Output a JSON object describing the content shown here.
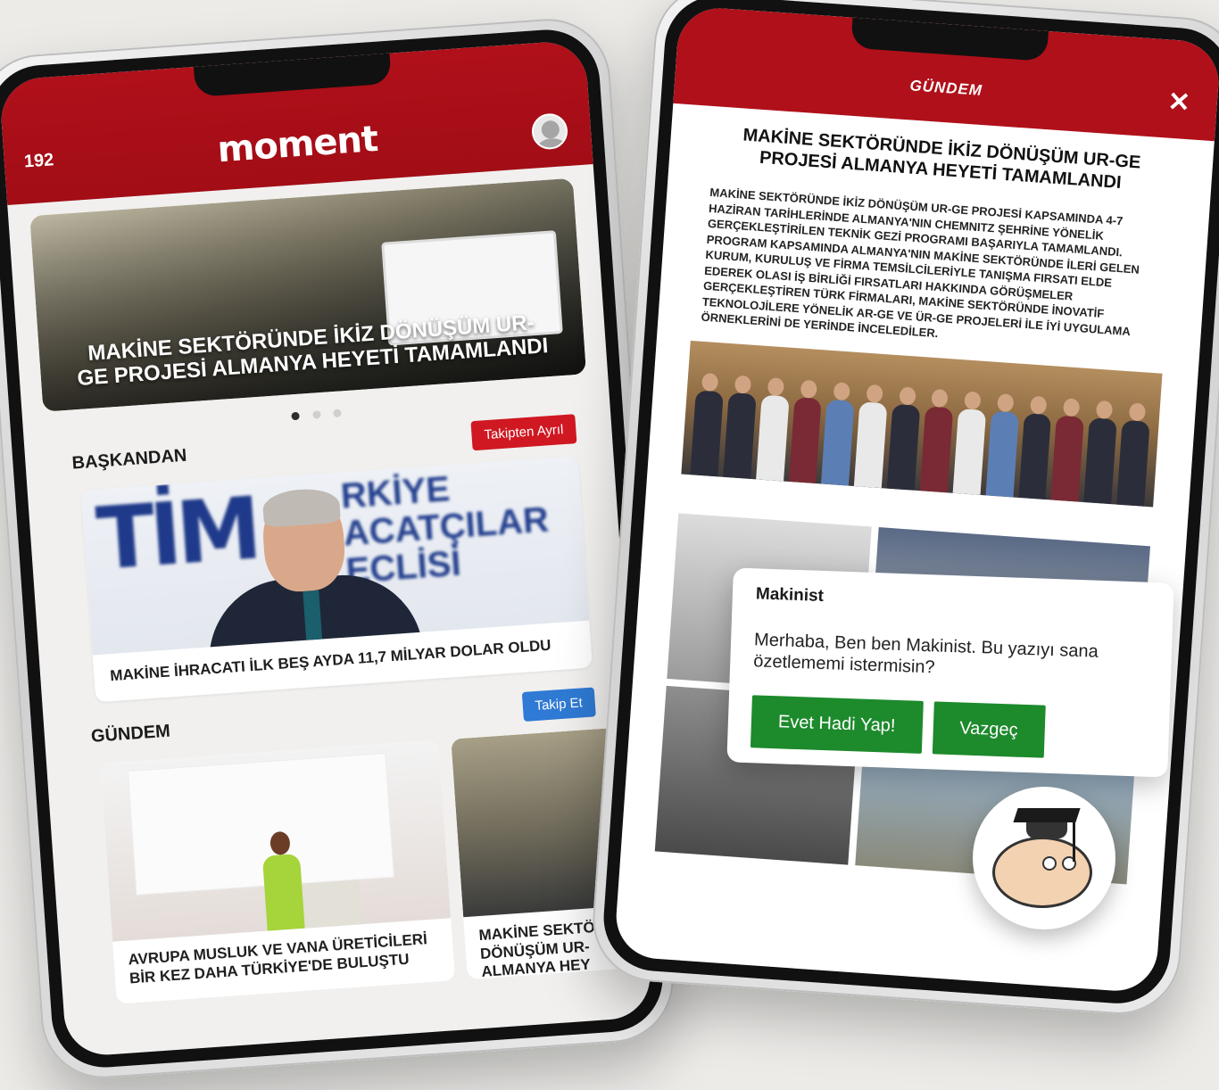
{
  "left_app": {
    "counter": "192",
    "logo": "moment",
    "hero": {
      "title": "MAKİNE SEKTÖRÜNDE İKİZ DÖNÜŞÜM UR-GE PROJESİ ALMANYA HEYETİ TAMAMLANDI"
    },
    "carousel_pages": 3,
    "baskandan": {
      "title": "BAŞKANDAN",
      "button": "Takipten Ayrıl",
      "card_logo": "TİM",
      "card_logo_sub": "RKİYE ACATÇILAR ECLİSİ",
      "card_text": "MAKİNE İHRACATI İLK BEŞ AYDA 11,7 MİLYAR DOLAR OLDU"
    },
    "gundem": {
      "title": "GÜNDEM",
      "button": "Takip Et",
      "cards": [
        {
          "text": "AVRUPA MUSLUK VE VANA ÜRETİCİLERİ BİR KEZ DAHA TÜRKİYE'DE BULUŞTU"
        },
        {
          "text": "MAKİNE SEKTÖ DÖNÜŞÜM UR- ALMANYA HEY"
        }
      ]
    }
  },
  "right_app": {
    "header": "GÜNDEM",
    "close": "✕",
    "headline": "MAKİNE SEKTÖRÜNDE İKİZ DÖNÜŞÜM UR-GE PROJESİ ALMANYA HEYETİ TAMAMLANDI",
    "body": "MAKİNE SEKTÖRÜNDE İKİZ DÖNÜŞÜM UR-GE PROJESİ KAPSAMINDA 4-7 HAZİRAN TARİHLERİNDE ALMANYA'NIN CHEMNITZ ŞEHRİNE YÖNELİK GERÇEKLEŞTİRİLEN TEKNİK GEZİ PROGRAMI BAŞARIYLA TAMAMLANDI. PROGRAM KAPSAMINDA ALMANYA'NIN MAKİNE SEKTÖRÜNDE İLERİ GELEN KURUM, KURULUŞ VE FİRMA TEMSİLCİLERİYLE TANIŞMA FIRSATI ELDE EDEREK OLASI İŞ BİRLİĞİ FIRSATLARI HAKKINDA GÖRÜŞMELER GERÇEKLEŞTİREN TÜRK FİRMALARI, MAKİNE SEKTÖRÜNDE İNOVATİF TEKNOLOJİLERE YÖNELİK AR-GE VE ÜR-GE PROJELERİ İLE İYİ UYGULAMA ÖRNEKLERİNİ DE YERİNDE İNCELEDİLER."
  },
  "chat": {
    "name": "Makinist",
    "message": "Merhaba, Ben ben Makinist. Bu yazıyı sana özetlememi istermisin?",
    "confirm": "Evet Hadi Yap!",
    "cancel": "Vazgeç"
  },
  "colors": {
    "brand_red": "#b0101a",
    "follow_blue": "#2f7ad4",
    "chat_green": "#1d8a2c"
  }
}
